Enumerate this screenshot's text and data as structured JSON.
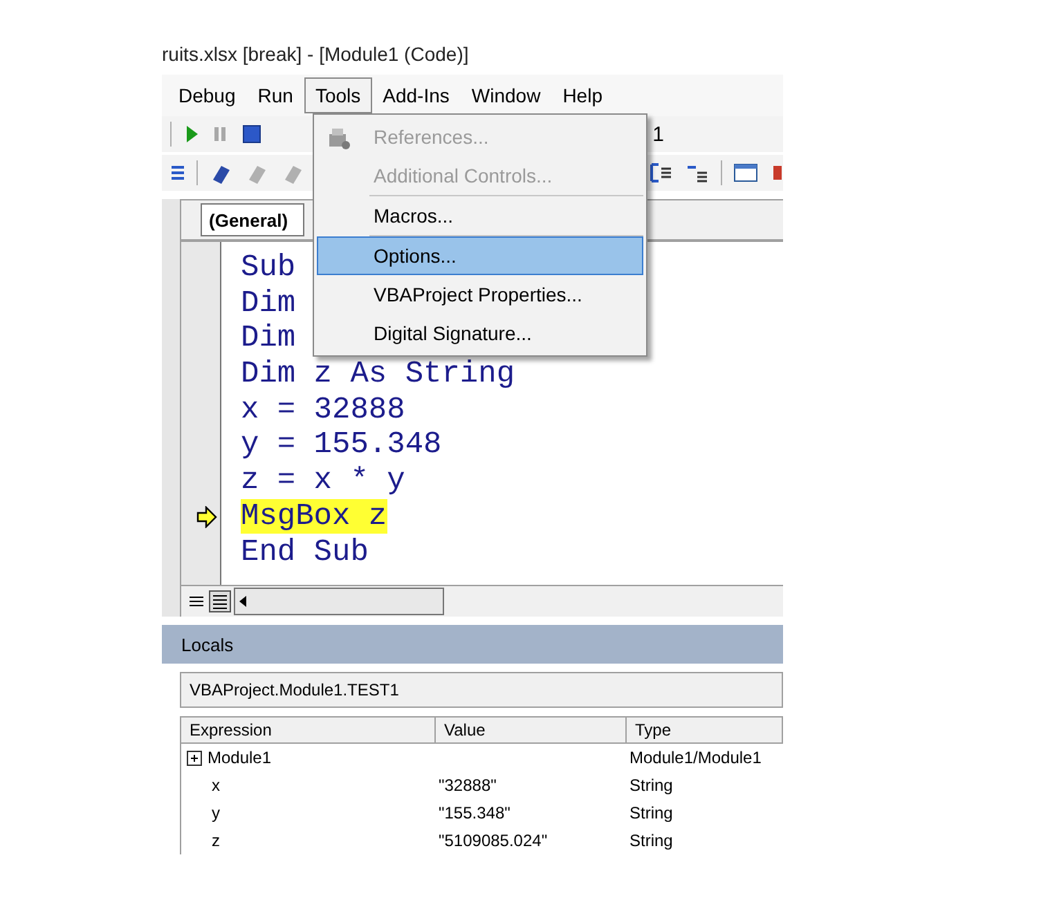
{
  "window": {
    "title": "ruits.xlsx [break] - [Module1 (Code)]"
  },
  "menubar": [
    {
      "label": "Debug",
      "selected": false
    },
    {
      "label": "Run",
      "selected": false
    },
    {
      "label": "Tools",
      "selected": true
    },
    {
      "label": "Add-Ins",
      "selected": false
    },
    {
      "label": "Window",
      "selected": false
    },
    {
      "label": "Help",
      "selected": false
    }
  ],
  "toolbar": {
    "text": "1"
  },
  "tools_menu": {
    "items": [
      {
        "kind": "item",
        "label": "References...",
        "disabled": true,
        "selected": false,
        "icon": true
      },
      {
        "kind": "item",
        "label": "Additional Controls...",
        "disabled": true,
        "selected": false,
        "icon": false
      },
      {
        "kind": "separator"
      },
      {
        "kind": "item",
        "label": "Macros...",
        "disabled": false,
        "selected": false,
        "icon": false
      },
      {
        "kind": "separator"
      },
      {
        "kind": "item",
        "label": "Options...",
        "disabled": false,
        "selected": true,
        "icon": false
      },
      {
        "kind": "item",
        "label": "VBAProject Properties...",
        "disabled": false,
        "selected": false,
        "icon": false
      },
      {
        "kind": "item",
        "label": "Digital Signature...",
        "disabled": false,
        "selected": false,
        "icon": false
      }
    ]
  },
  "code": {
    "procedure": "(General)",
    "lines": [
      {
        "text": "Sub",
        "current": false
      },
      {
        "text": "Dim",
        "current": false
      },
      {
        "text": "Dim",
        "current": false
      },
      {
        "text": "Dim z As String",
        "current": false
      },
      {
        "text": "x = 32888",
        "current": false
      },
      {
        "text": "y = 155.348",
        "current": false
      },
      {
        "text": "z = x * y",
        "current": false
      },
      {
        "text": "MsgBox z",
        "current": true
      },
      {
        "text": "End Sub",
        "current": false
      }
    ]
  },
  "locals": {
    "title": "Locals",
    "context": "VBAProject.Module1.TEST1",
    "columns": [
      "Expression",
      "Value",
      "Type"
    ],
    "rows": [
      {
        "expression": "Module1",
        "type": "Module1/Module1",
        "expandable": true
      },
      {
        "expression": "x",
        "value": "\"32888\"",
        "type": "String",
        "expandable": false
      },
      {
        "expression": "y",
        "value": "\"155.348\"",
        "type": "String",
        "expandable": false
      },
      {
        "expression": "z",
        "value": "\"5109085.024\"",
        "type": "String",
        "expandable": false
      }
    ]
  }
}
